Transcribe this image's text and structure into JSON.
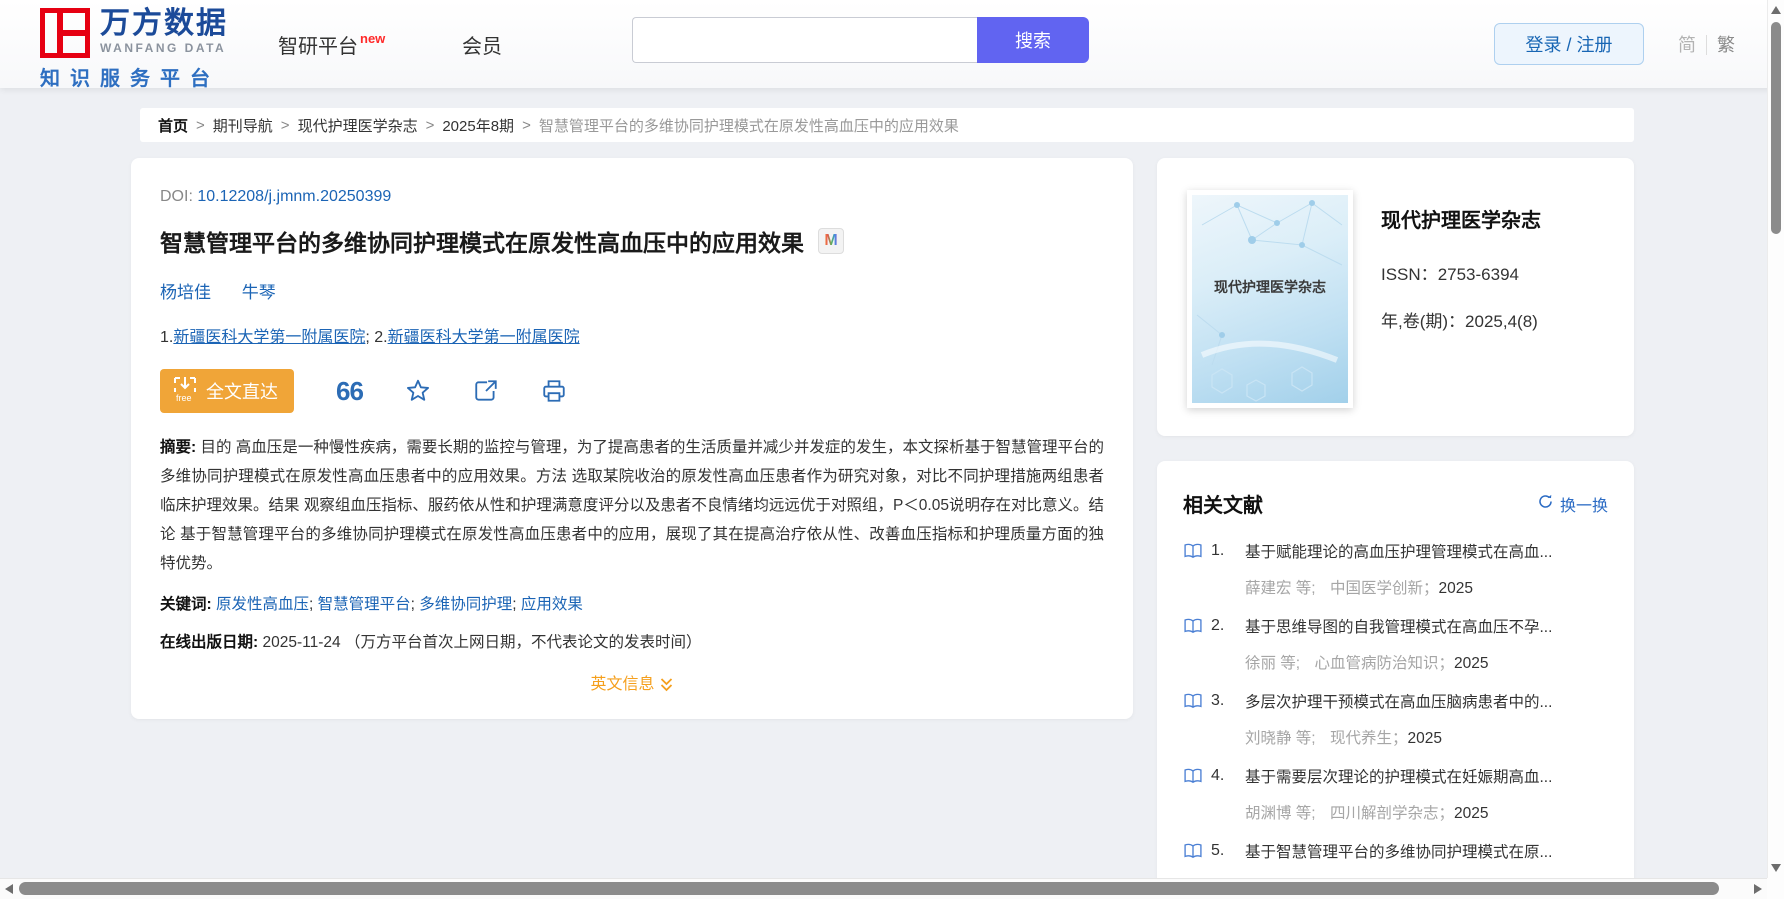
{
  "colors": {
    "logo_red": "#e60012",
    "brand_blue": "#1b4a99",
    "search_purple": "#6164f1",
    "link_blue": "#1b64b5",
    "related_blue": "#2b6bc4",
    "orange": "#f0a538",
    "orange_text": "#f59f1c"
  },
  "header": {
    "logo": {
      "brand": "万方数据",
      "brand_en": "WANFANG DATA",
      "tagline": "知识服务平台"
    },
    "nav": {
      "zhiyan": "智研平台",
      "zhiyan_badge": "new",
      "member": "会员"
    },
    "search": {
      "value": "",
      "button": "搜索"
    },
    "login": "登录 / 注册",
    "lang": {
      "simplified": "简",
      "traditional": "繁"
    }
  },
  "breadcrumb": {
    "separator": ">",
    "items": [
      "首页",
      "期刊导航",
      "现代护理医学杂志",
      "2025年8期"
    ],
    "current": "智慧管理平台的多维协同护理模式在原发性高血压中的应用效果"
  },
  "article": {
    "doi_label": "DOI:",
    "doi": "10.12208/j.jmnm.20250399",
    "title": "智慧管理平台的多维协同护理模式在原发性高血压中的应用效果",
    "badge": "M",
    "authors": [
      "杨培佳",
      "牛琴"
    ],
    "affiliations": {
      "num1": "1.",
      "name1": "新疆医科大学第一附属医院",
      "sep": "; ",
      "num2": "2.",
      "name2": "新疆医科大学第一附属医院"
    },
    "toolbar": {
      "fulltext_label": "全文直达",
      "free_label": "free",
      "cite_glyph": "66"
    },
    "abstract_label": "摘要:",
    "abstract": "目的 高血压是一种慢性疾病，需要长期的监控与管理，为了提高患者的生活质量并减少并发症的发生，本文探析基于智慧管理平台的多维协同护理模式在原发性高血压患者中的应用效果。方法 选取某院收治的原发性高血压患者作为研究对象，对比不同护理措施两组患者临床护理效果。结果 观察组血压指标、服药依从性和护理满意度评分以及患者不良情绪均远远优于对照组，P＜0.05说明存在对比意义。结论 基于智慧管理平台的多维协同护理模式在原发性高血压患者中的应用，展现了其在提高治疗依从性、改善血压指标和护理质量方面的独特优势。",
    "keywords_label": "关键词:",
    "kw1": "原发性高血压",
    "kw2": "智慧管理平台",
    "kw3": "多维协同护理",
    "kw4": "应用效果",
    "kw_sep": "; ",
    "online_date_label": "在线出版日期:",
    "online_date": "2025-11-24",
    "online_date_note": "（万方平台首次上网日期，不代表论文的发表时间）",
    "english_info": "英文信息"
  },
  "journal": {
    "cover_title": "现代护理医学杂志",
    "name": "现代护理医学杂志",
    "issn_label": "ISSN：",
    "issn": "2753-6394",
    "volume_label": "年,卷(期)：",
    "volume": "2025,4(8)"
  },
  "related": {
    "title": "相关文献",
    "refresh": "换一换",
    "items": [
      {
        "num": "1.",
        "title": "基于赋能理论的高血压护理管理模式在高血...",
        "authors": "薛建宏  等;",
        "journal": "中国医学创新",
        "sep": "；",
        "year": "2025"
      },
      {
        "num": "2.",
        "title": "基于思维导图的自我管理模式在高血压不孕...",
        "authors": "徐丽  等;",
        "journal": "心血管病防治知识",
        "sep": "；",
        "year": "2025"
      },
      {
        "num": "3.",
        "title": "多层次护理干预模式在高血压脑病患者中的...",
        "authors": "刘晓静  等;",
        "journal": "现代养生",
        "sep": "；",
        "year": "2025"
      },
      {
        "num": "4.",
        "title": "基于需要层次理论的护理模式在妊娠期高血...",
        "authors": "胡渊博  等;",
        "journal": "四川解剖学杂志",
        "sep": "；",
        "year": "2025"
      },
      {
        "num": "5.",
        "title": "基于智慧管理平台的多维协同护理模式在原..."
      }
    ]
  }
}
